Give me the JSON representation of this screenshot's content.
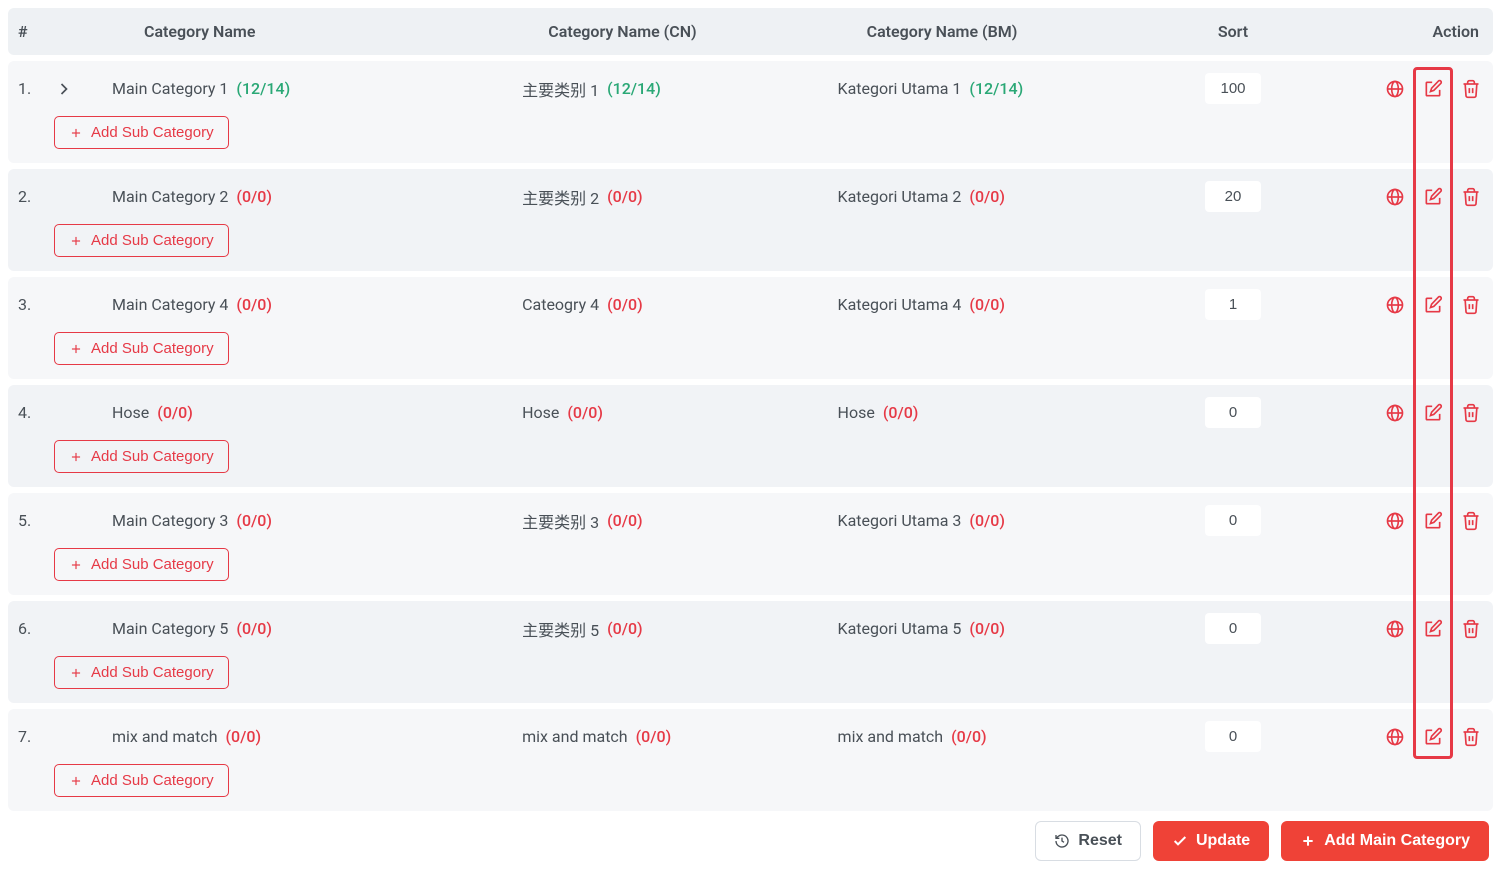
{
  "headers": {
    "index": "#",
    "name": "Category Name",
    "cn": "Category Name (CN)",
    "bm": "Category Name (BM)",
    "sort": "Sort",
    "action": "Action"
  },
  "add_sub_label": "Add Sub Category",
  "rows": [
    {
      "num": "1.",
      "name": "Main Category 1",
      "name_count": "(12/14)",
      "cn": "主要类别 1",
      "cn_count": "(12/14)",
      "bm": "Kategori Utama 1",
      "bm_count": "(12/14)",
      "count_class": "green",
      "sort": "100",
      "has_chevron": true
    },
    {
      "num": "2.",
      "name": "Main Category 2",
      "name_count": "(0/0)",
      "cn": "主要类别 2",
      "cn_count": "(0/0)",
      "bm": "Kategori Utama 2",
      "bm_count": "(0/0)",
      "count_class": "red",
      "sort": "20",
      "has_chevron": false
    },
    {
      "num": "3.",
      "name": "Main Category 4",
      "name_count": "(0/0)",
      "cn": "Cateogry 4",
      "cn_count": "(0/0)",
      "bm": "Kategori Utama 4",
      "bm_count": "(0/0)",
      "count_class": "red",
      "sort": "1",
      "has_chevron": false
    },
    {
      "num": "4.",
      "name": "Hose",
      "name_count": "(0/0)",
      "cn": "Hose",
      "cn_count": "(0/0)",
      "bm": "Hose",
      "bm_count": "(0/0)",
      "count_class": "red",
      "sort": "0",
      "has_chevron": false
    },
    {
      "num": "5.",
      "name": "Main Category 3",
      "name_count": "(0/0)",
      "cn": "主要类别 3",
      "cn_count": "(0/0)",
      "bm": "Kategori Utama 3",
      "bm_count": "(0/0)",
      "count_class": "red",
      "sort": "0",
      "has_chevron": false
    },
    {
      "num": "6.",
      "name": "Main Category 5",
      "name_count": "(0/0)",
      "cn": "主要类别 5",
      "cn_count": "(0/0)",
      "bm": "Kategori Utama 5",
      "bm_count": "(0/0)",
      "count_class": "red",
      "sort": "0",
      "has_chevron": false
    },
    {
      "num": "7.",
      "name": "mix and match",
      "name_count": "(0/0)",
      "cn": "mix and match",
      "cn_count": "(0/0)",
      "bm": "mix and match",
      "bm_count": "(0/0)",
      "count_class": "red",
      "sort": "0",
      "has_chevron": false
    }
  ],
  "footer": {
    "reset": "Reset",
    "update": "Update",
    "add_main": "Add Main Category"
  }
}
